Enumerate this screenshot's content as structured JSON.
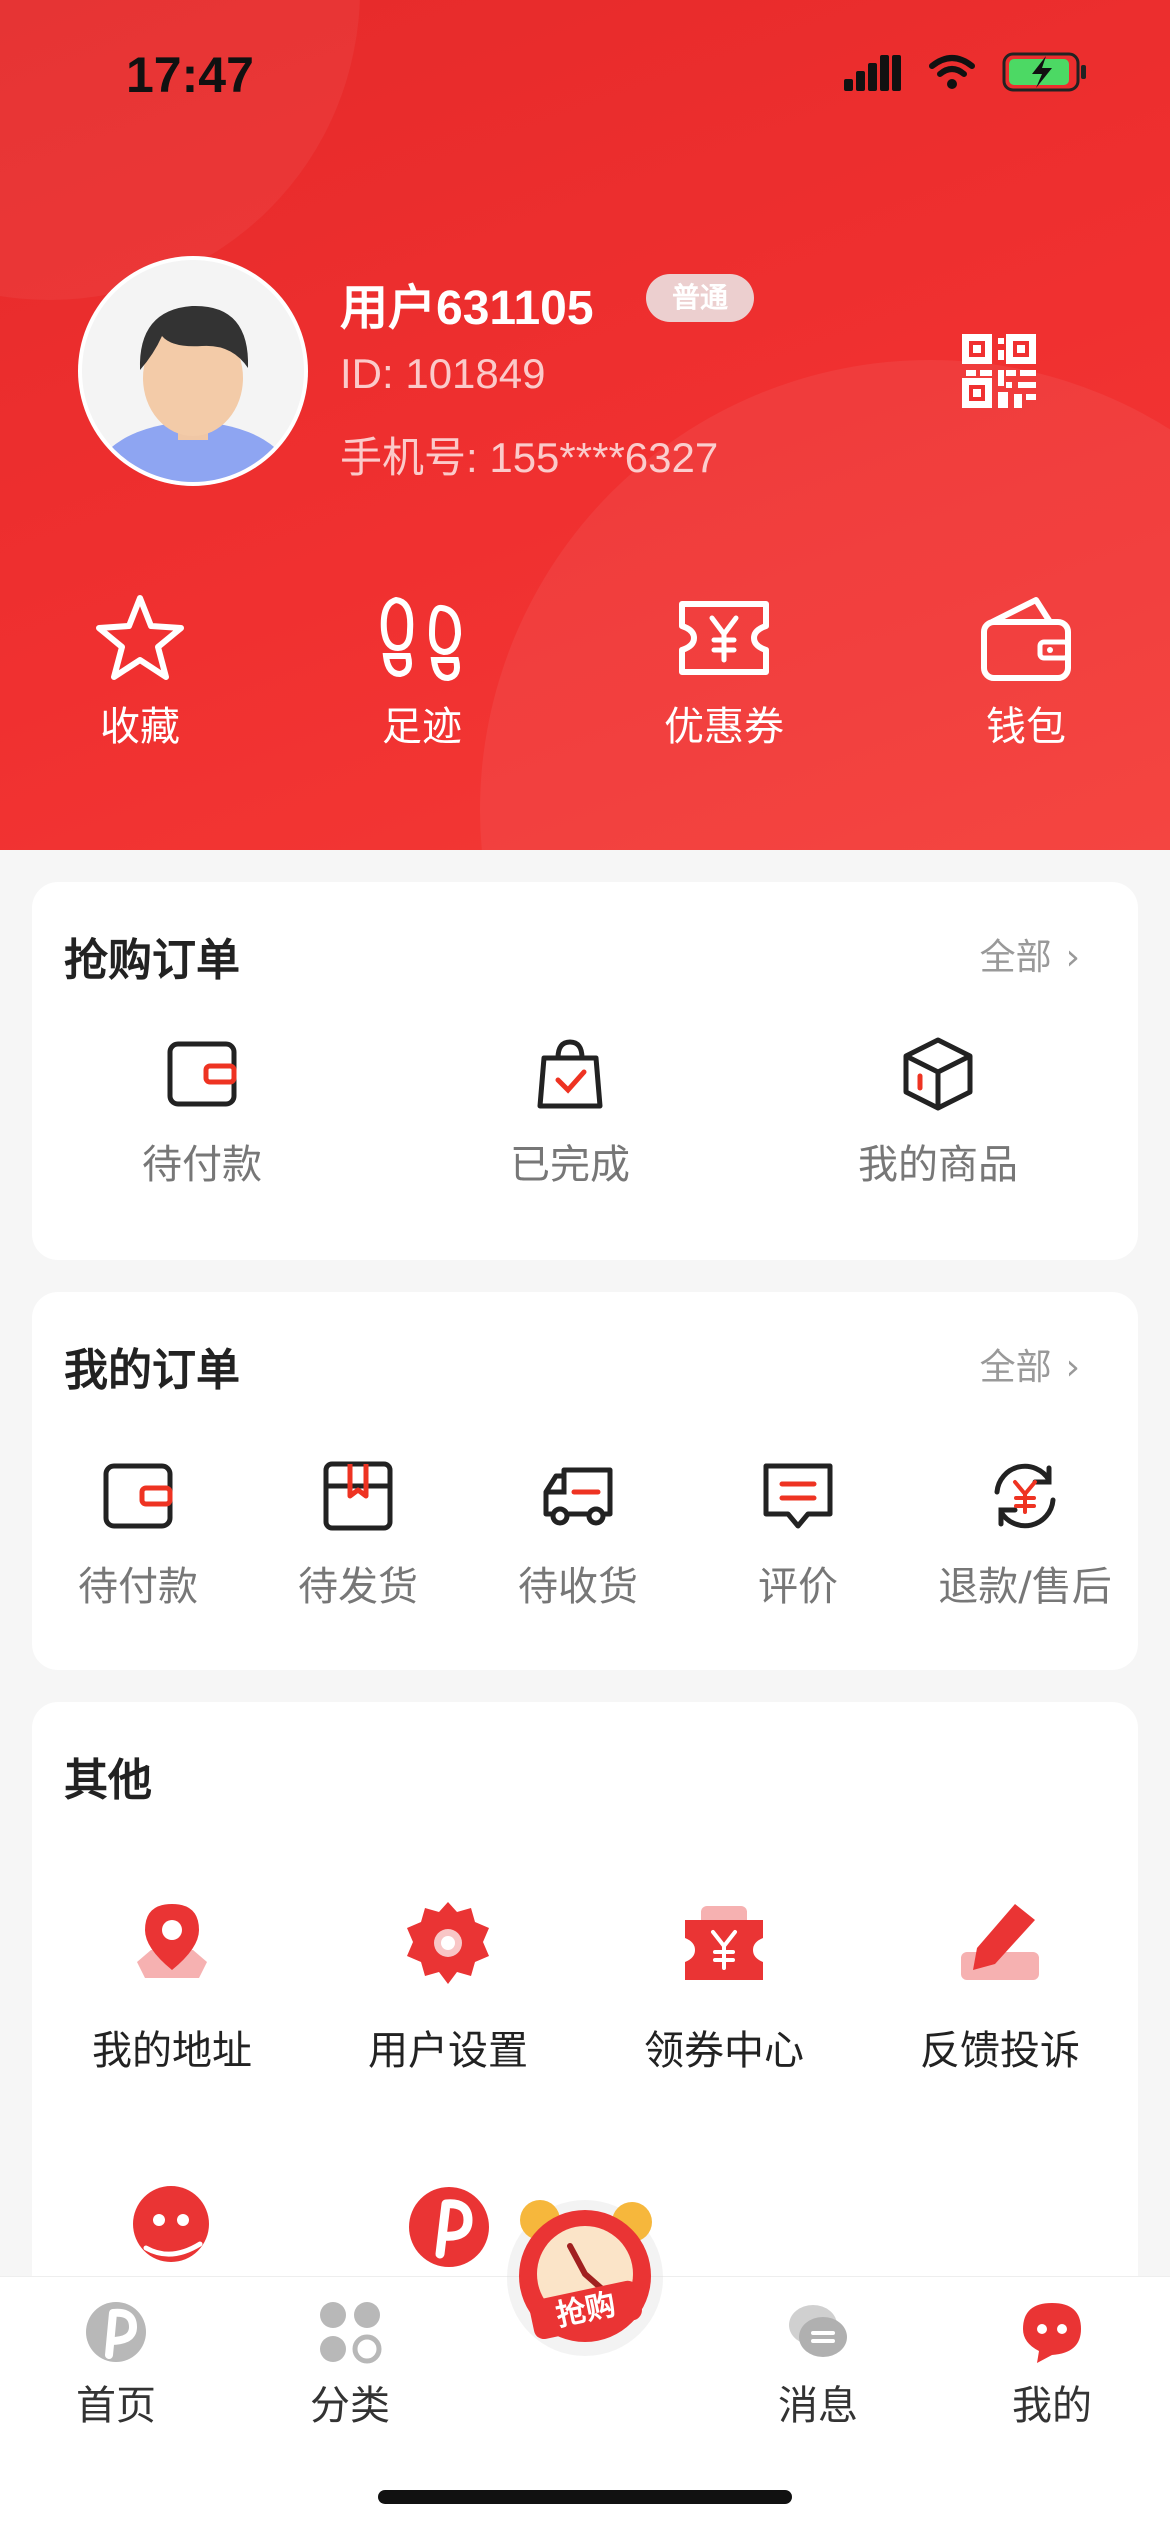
{
  "status_bar": {
    "time": "17:47"
  },
  "profile": {
    "username": "用户631105",
    "level_badge": "普通",
    "id_text": "ID: 101849",
    "phone_text": "手机号: 155****6327"
  },
  "quick_actions": [
    {
      "label": "收藏",
      "icon": "star-icon"
    },
    {
      "label": "足迹",
      "icon": "footprint-icon"
    },
    {
      "label": "优惠券",
      "icon": "coupon-icon"
    },
    {
      "label": "钱包",
      "icon": "wallet-icon"
    }
  ],
  "flash_orders": {
    "title": "抢购订单",
    "more": "全部",
    "items": [
      {
        "label": "待付款",
        "icon": "wallet-icon"
      },
      {
        "label": "已完成",
        "icon": "shopping-bag-check-icon"
      },
      {
        "label": "我的商品",
        "icon": "box-icon"
      }
    ]
  },
  "my_orders": {
    "title": "我的订单",
    "more": "全部",
    "items": [
      {
        "label": "待付款",
        "icon": "wallet-icon"
      },
      {
        "label": "待发货",
        "icon": "package-icon"
      },
      {
        "label": "待收货",
        "icon": "truck-icon"
      },
      {
        "label": "评价",
        "icon": "comment-icon"
      },
      {
        "label": "退款/售后",
        "icon": "refund-icon"
      }
    ]
  },
  "others": {
    "title": "其他",
    "items": [
      {
        "label": "我的地址",
        "icon": "location-pin-icon"
      },
      {
        "label": "用户设置",
        "icon": "settings-gear-icon"
      },
      {
        "label": "领券中心",
        "icon": "coupon-center-icon"
      },
      {
        "label": "反馈投诉",
        "icon": "feedback-pencil-icon"
      },
      {
        "label": "",
        "icon": "customer-service-icon"
      },
      {
        "label": "",
        "icon": "p-logo-icon"
      }
    ]
  },
  "tabbar": {
    "items": [
      {
        "label": "首页",
        "icon": "home-p-icon"
      },
      {
        "label": "分类",
        "icon": "category-icon"
      },
      {
        "label": "消息",
        "icon": "message-icon"
      },
      {
        "label": "我的",
        "icon": "profile-chat-icon"
      }
    ],
    "center_button_label": "抢购"
  },
  "colors": {
    "primary": "#f03030",
    "card_bg": "#ffffff",
    "page_bg": "#f6f6f6"
  }
}
